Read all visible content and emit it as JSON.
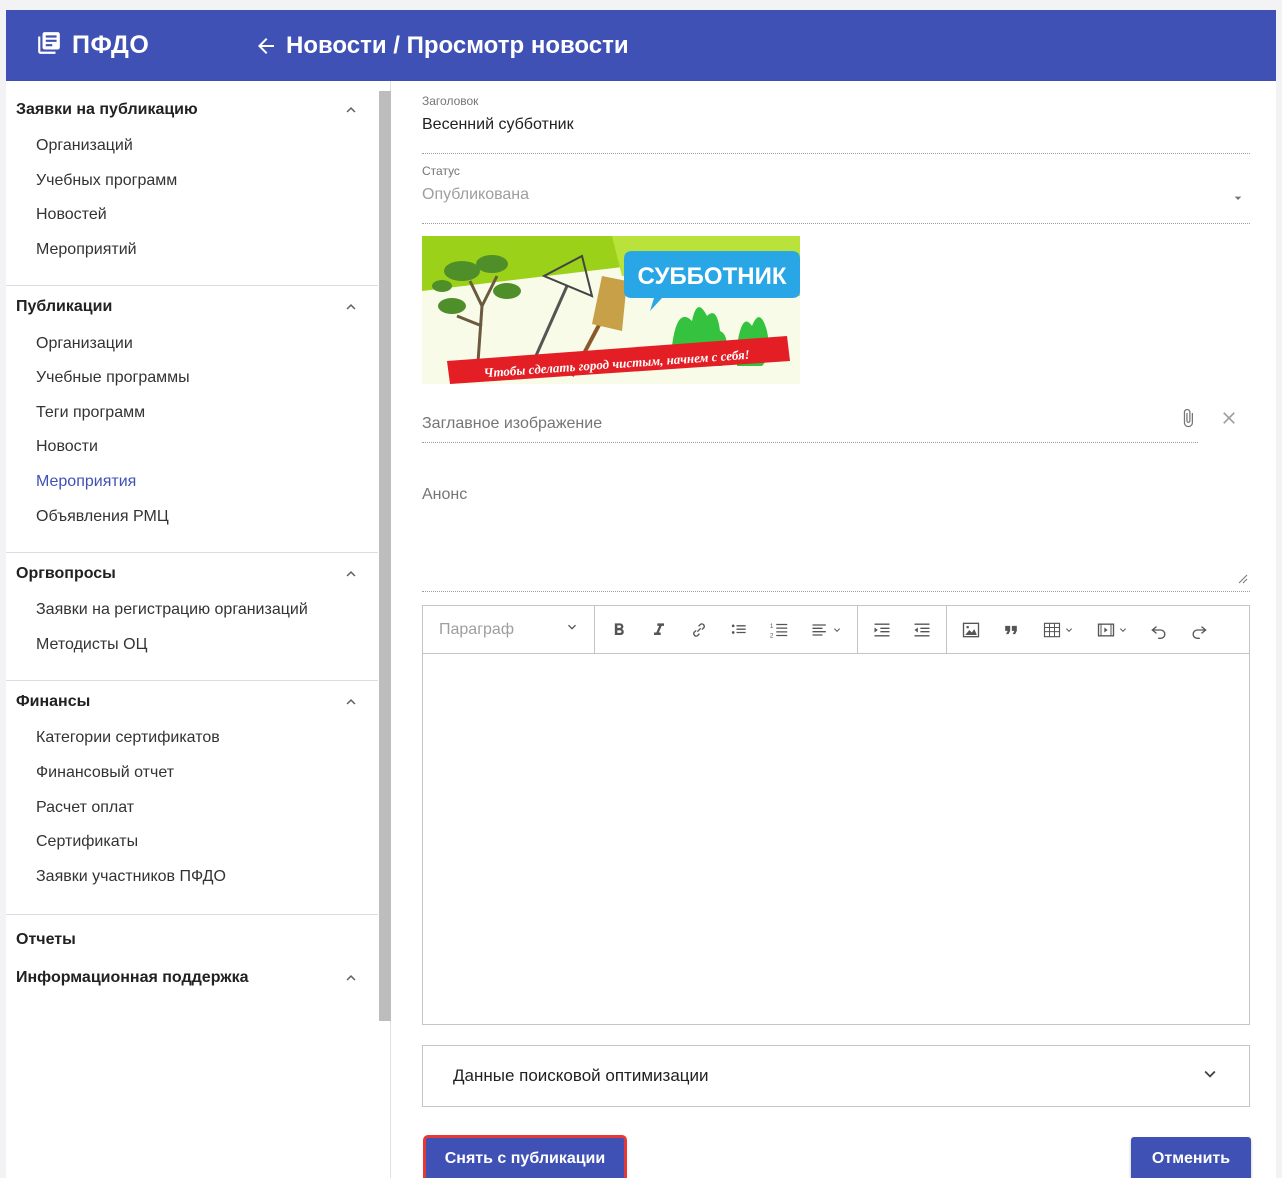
{
  "app": {
    "brand": "ПФДО"
  },
  "header": {
    "title": "Новости / Просмотр новости"
  },
  "sidebar": {
    "sections": [
      {
        "title": "Заявки на публикацию",
        "items": [
          "Организаций",
          "Учебных программ",
          "Новостей",
          "Мероприятий"
        ]
      },
      {
        "title": "Публикации",
        "items": [
          "Организации",
          "Учебные программы",
          "Теги программ",
          "Новости",
          "Мероприятия",
          "Объявления РМЦ"
        ],
        "active": "Мероприятия"
      },
      {
        "title": "Оргвопросы",
        "items": [
          "Заявки на регистрацию организаций",
          "Методисты ОЦ"
        ]
      },
      {
        "title": "Финансы",
        "items": [
          "Категории сертификатов",
          "Финансовый отчет",
          "Расчет оплат",
          "Сертификаты",
          "Заявки участников ПФДО"
        ]
      },
      {
        "title": "Отчеты",
        "items": []
      },
      {
        "title": "Информационная поддержка",
        "items": []
      }
    ]
  },
  "form": {
    "headline_label": "Заголовок",
    "headline_value": "Весенний субботник",
    "status_label": "Статус",
    "status_value": "Опубликована",
    "image_label": "Заглавное изображение",
    "image_banner_title": "СУББОТНИК",
    "image_banner_slogan": "Чтобы сделать город чистым, начнем с себя!",
    "announce_label": "Анонс",
    "editor_paragraph": "Параграф",
    "seo_label": "Данные поисковой оптимизации"
  },
  "buttons": {
    "unpublish": "Снять с публикации",
    "cancel": "Отменить"
  },
  "colors": {
    "primary": "#3f51b5",
    "highlight": "#e53935"
  }
}
